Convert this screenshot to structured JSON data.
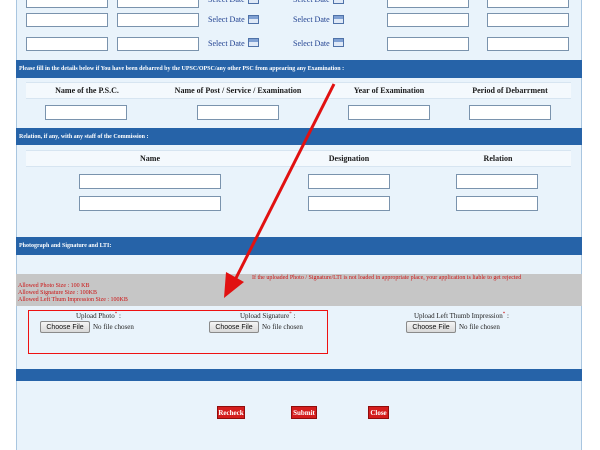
{
  "date_rows": {
    "select_date_label": "Select Date"
  },
  "debarment": {
    "section_title": "Please fill in the details below if You have been debarred by the UPSC/OPSC/any other PSC from appearing any Examination :",
    "columns": [
      "Name of the P.S.C.",
      "Name of Post / Service / Examination",
      "Year of Examination",
      "Period of Debarrment"
    ]
  },
  "relation": {
    "section_title": "Relation, if any, with any staff of the Commission :",
    "columns": [
      "Name",
      "Designation",
      "Relation"
    ]
  },
  "photo": {
    "section_title": "Photograph and Signature and LTI:",
    "warning": "If the uploaded Photo / Signature/LTI is not loaded in appropriate place, your application is liable to get rejected",
    "limits": [
      "Allowed Photo Size : 100 KB",
      "Allowed Signature Size : 100KB",
      "Allowed Left Thum Impression Size : 100KB"
    ],
    "uploads": [
      {
        "label": "Upload Photo",
        "button": "Choose File",
        "status": "No file chosen"
      },
      {
        "label": "Upload Signature",
        "button": "Choose File",
        "status": "No file chosen"
      },
      {
        "label": "Upload Left Thumb Impression",
        "button": "Choose File",
        "status": "No file chosen"
      }
    ],
    "required_mark": "*",
    "label_suffix": " :"
  },
  "actions": {
    "recheck": "Recheck",
    "submit": "Submit",
    "close": "Close"
  },
  "colors": {
    "band": "#2663a8",
    "annotation": "#e11111",
    "action_button": "#d41d1d"
  }
}
